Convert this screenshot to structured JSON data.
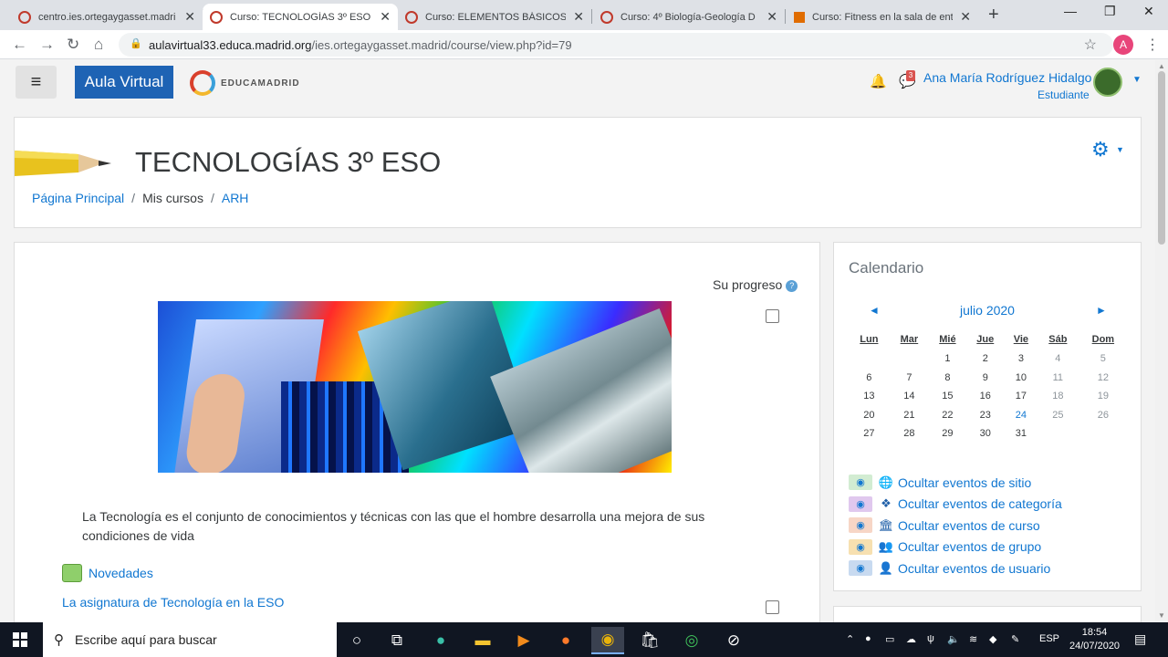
{
  "browser": {
    "tabs": [
      {
        "title": "centro.ies.ortegaygasset.madri",
        "active": false
      },
      {
        "title": "Curso: TECNOLOGÍAS 3º ESO",
        "active": true
      },
      {
        "title": "Curso: ELEMENTOS BÁSICOS D",
        "active": false
      },
      {
        "title": "Curso: 4º Biología-Geología D",
        "active": false
      },
      {
        "title": "Curso: Fitness en la sala de ent",
        "active": false
      }
    ],
    "tab_close": "✕",
    "new_tab": "+",
    "url_host": "aulavirtual33.educa.madrid.org",
    "url_path": "/ies.ortegaygasset.madrid/course/view.php?id=79",
    "profile_initial": "A"
  },
  "navbar": {
    "brand": "Aula Virtual",
    "logo_text": "EDUCAMADRID",
    "message_count": "3",
    "user_name": "Ana María Rodríguez Hidalgo",
    "user_role": "Estudiante"
  },
  "header": {
    "course_title": "TECNOLOGÍAS 3º ESO",
    "breadcrumb": [
      "Página Principal",
      "Mis cursos",
      "ARH"
    ],
    "breadcrumb_sep": "/"
  },
  "main": {
    "progress_label": "Su progreso",
    "help_glyph": "?",
    "description": "La Tecnología es el conjunto de conocimientos y técnicas con las que el hombre desarrolla una mejora de sus condiciones de vida",
    "activities": [
      {
        "label": "Novedades",
        "icon": "forum-icon"
      },
      {
        "label": "La asignatura de Tecnología en la ESO",
        "icon": "page-icon"
      }
    ]
  },
  "calendar": {
    "heading": "Calendario",
    "month": "julio 2020",
    "prev": "◄",
    "next": "►",
    "weekdays": [
      "Lun",
      "Mar",
      "Mié",
      "Jue",
      "Vie",
      "Sáb",
      "Dom"
    ],
    "weeks": [
      [
        "",
        "",
        "1",
        "2",
        "3",
        "4",
        "5"
      ],
      [
        "6",
        "7",
        "8",
        "9",
        "10",
        "11",
        "12"
      ],
      [
        "13",
        "14",
        "15",
        "16",
        "17",
        "18",
        "19"
      ],
      [
        "20",
        "21",
        "22",
        "23",
        "24",
        "25",
        "26"
      ],
      [
        "27",
        "28",
        "29",
        "30",
        "31",
        "",
        ""
      ]
    ],
    "today": "24",
    "event_filters": [
      {
        "label": "Ocultar eventos de sitio",
        "color": "#d2ecd2",
        "icon": "globe-icon",
        "glyph": "🌐"
      },
      {
        "label": "Ocultar eventos de categoría",
        "color": "#e0c8ee",
        "icon": "cubes-icon",
        "glyph": "❖"
      },
      {
        "label": "Ocultar eventos de curso",
        "color": "#f7d6c6",
        "icon": "university-icon",
        "glyph": "🏛"
      },
      {
        "label": "Ocultar eventos de grupo",
        "color": "#f7e0b0",
        "icon": "users-icon",
        "glyph": "👥"
      },
      {
        "label": "Ocultar eventos de usuario",
        "color": "#c8daf0",
        "icon": "user-icon",
        "glyph": "👤"
      }
    ]
  },
  "taskbar": {
    "search_placeholder": "Escribe aquí para buscar",
    "lang": "ESP",
    "time": "18:54",
    "date": "24/07/2020"
  }
}
